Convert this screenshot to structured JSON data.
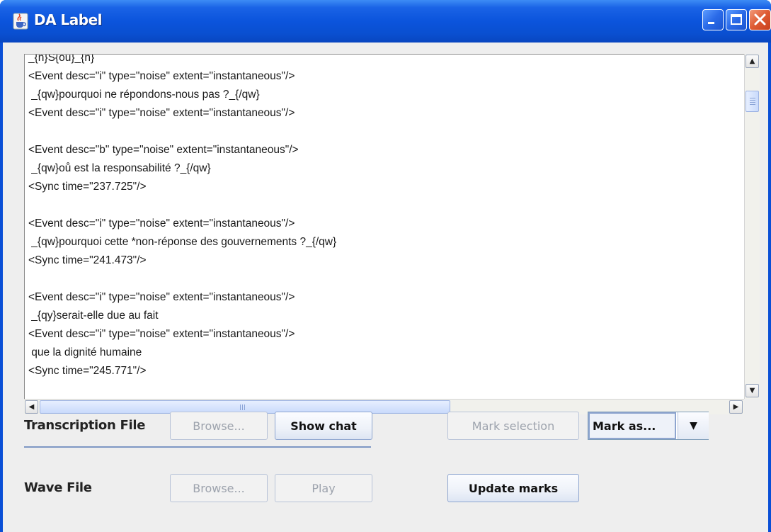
{
  "window": {
    "title": "DA Label"
  },
  "transcript": {
    "lines": [
      "_{n}S{ou}_{n}",
      "<Event desc=\"i\" type=\"noise\" extent=\"instantaneous\"/>",
      " _{qw}pourquoi ne répondons-nous pas ?_{/qw}",
      "<Event desc=\"i\" type=\"noise\" extent=\"instantaneous\"/>",
      "",
      "<Event desc=\"b\" type=\"noise\" extent=\"instantaneous\"/>",
      " _{qw}oů est la responsabilité ?_{/qw}",
      "<Sync time=\"237.725\"/>",
      "",
      "<Event desc=\"i\" type=\"noise\" extent=\"instantaneous\"/>",
      " _{qw}pourquoi cette *non-réponse des gouvernements ?_{/qw}",
      "<Sync time=\"241.473\"/>",
      "",
      "<Event desc=\"i\" type=\"noise\" extent=\"instantaneous\"/>",
      " _{qy}serait-elle due au fait",
      "<Event desc=\"i\" type=\"noise\" extent=\"instantaneous\"/>",
      " que la dignité humaine",
      "<Sync time=\"245.771\"/>"
    ]
  },
  "controls": {
    "transcription_label": "Transcription File",
    "wave_label": "Wave File",
    "browse_label": "Browse...",
    "show_chat_label": "Show chat",
    "play_label": "Play",
    "mark_selection_label": "Mark selection",
    "mark_as_value": "Mark as...",
    "update_marks_label": "Update marks"
  },
  "icons": {
    "app": "java-cup-icon",
    "minimize": "minimize-icon",
    "maximize": "maximize-icon",
    "close": "close-icon",
    "scroll_up": "scroll-up-arrow-icon",
    "scroll_down": "scroll-down-arrow-icon",
    "scroll_left": "scroll-left-arrow-icon",
    "scroll_right": "scroll-right-arrow-icon",
    "dropdown": "dropdown-arrow-icon"
  }
}
